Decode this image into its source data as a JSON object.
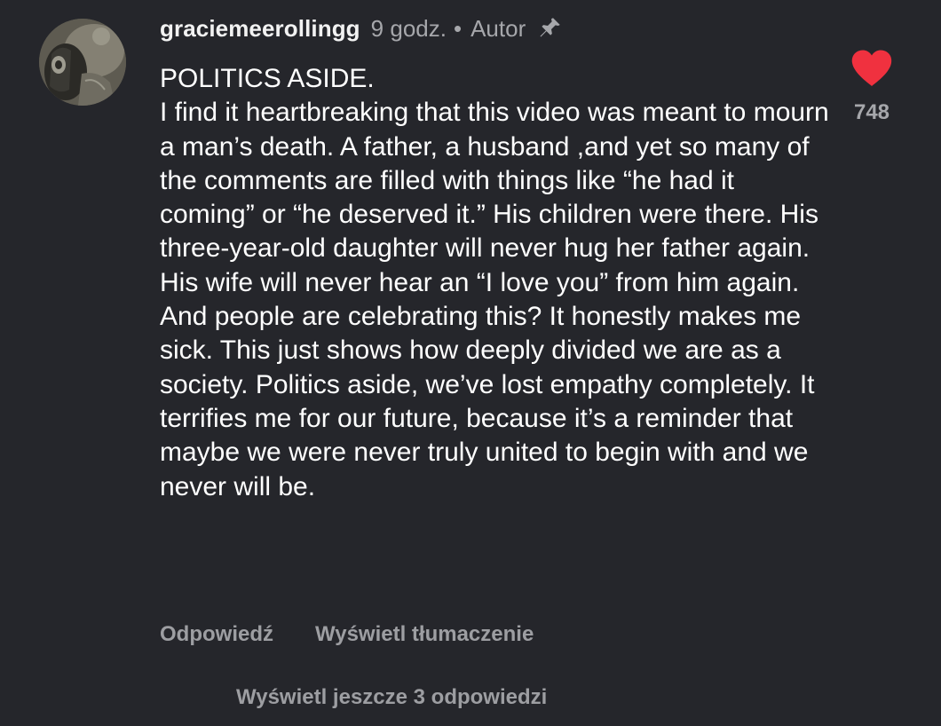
{
  "comment": {
    "username": "graciemeerollingg",
    "time_ago": "9 godz.",
    "separator": "•",
    "author_label": "Autor",
    "pin_icon": "pin-icon",
    "text": "POLITICS ASIDE.\nI find it heartbreaking that this video was meant to mourn a man’s death. A father, a husband ,and yet so many of the comments are filled with things like “he had it coming” or “he deserved it.” His children were there. His three-year-old daughter will never hug her father again. His wife will never hear an “I love you” from him again. And people are celebrating this? It honestly makes me sick. This just shows how deeply divided we are as a society. Politics aside, we’ve lost empathy completely. It terrifies me for our future, because it’s a reminder that maybe we were never truly united to begin with and we never will be.",
    "like_icon": "heart-icon",
    "like_count": "748",
    "liked": true,
    "like_color": "#f0313f"
  },
  "actions": {
    "reply_label": "Odpowiedź",
    "translate_label": "Wyświetl tłumaczenie"
  },
  "replies": {
    "more_label": "Wyświetl jeszcze 3 odpowiedzi"
  },
  "colors": {
    "background": "#25262b",
    "primary_text": "#ffffff",
    "secondary_text": "#a6a7ab"
  }
}
